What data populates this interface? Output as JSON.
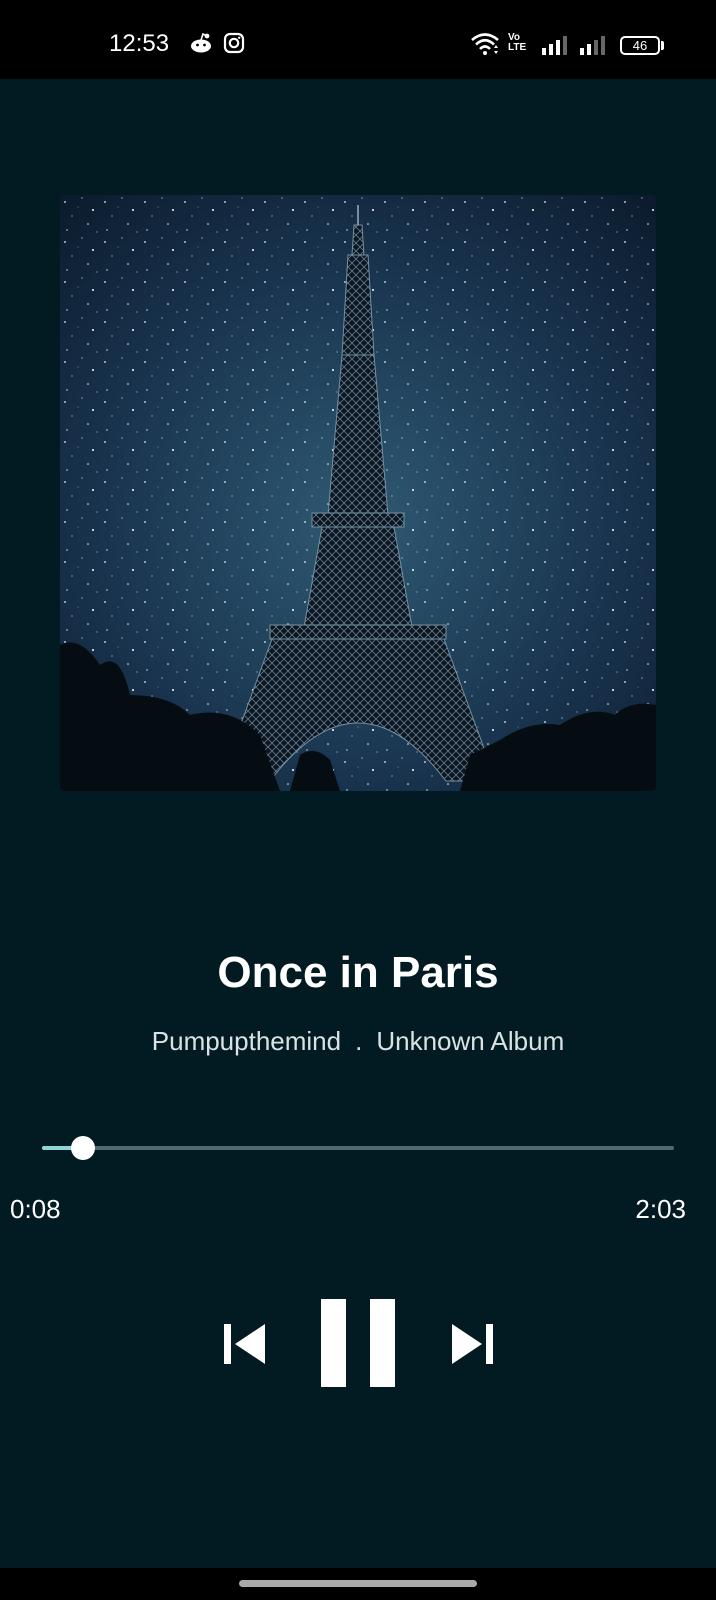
{
  "status_bar": {
    "time": "12:53",
    "battery": "46",
    "network_label": "Vo LTE"
  },
  "album": {
    "art_description_icon": "eiffel-tower-night-sky-image"
  },
  "track": {
    "title": "Once in Paris",
    "artist": "Pumpupthemind",
    "separator": ".",
    "album": "Unknown Album"
  },
  "playback": {
    "current_time": "0:08",
    "total_time": "2:03",
    "progress_fraction": 0.065,
    "state": "playing"
  },
  "controls": {
    "previous_icon": "skip-previous-icon",
    "pause_icon": "pause-icon",
    "next_icon": "skip-next-icon"
  },
  "colors": {
    "background": "#021b22",
    "accent": "#8fd6d6",
    "track": "#4e6a70"
  }
}
